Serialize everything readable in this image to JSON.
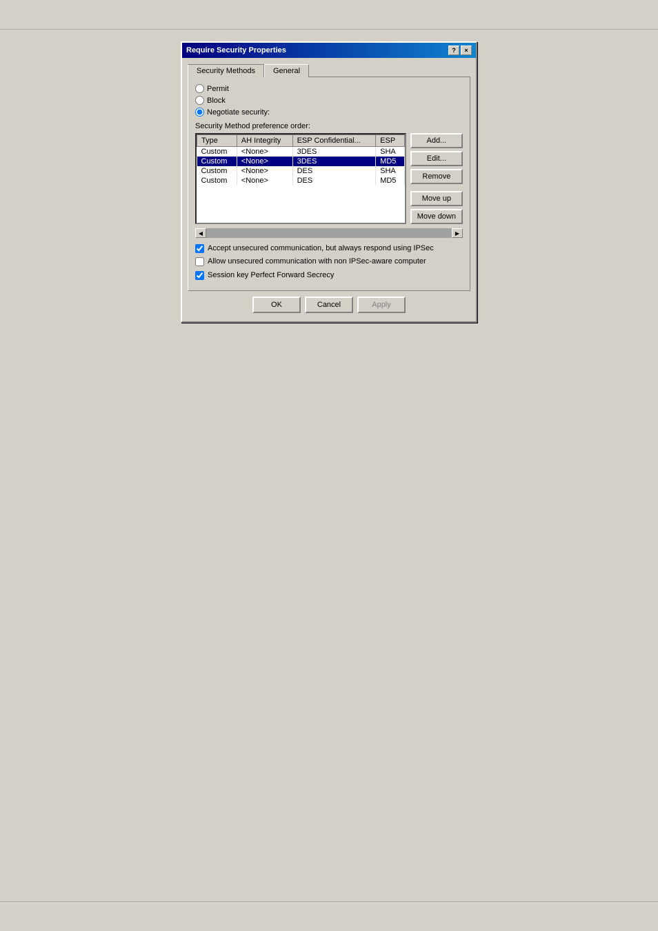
{
  "dialog": {
    "title": "Require Security Properties",
    "help_btn": "?",
    "close_btn": "×"
  },
  "tabs": [
    {
      "label": "Security Methods",
      "active": true
    },
    {
      "label": "General",
      "active": false
    }
  ],
  "radio_options": [
    {
      "id": "permit",
      "label": "Permit",
      "checked": false
    },
    {
      "id": "block",
      "label": "Block",
      "checked": false
    },
    {
      "id": "negotiate",
      "label": "Negotiate security:",
      "checked": true
    }
  ],
  "section_label": "Security Method preference order:",
  "table": {
    "columns": [
      "Type",
      "AH Integrity",
      "ESP Confidential...",
      "ESP"
    ],
    "rows": [
      [
        "Custom",
        "<None>",
        "3DES",
        "SHA"
      ],
      [
        "Custom",
        "<None>",
        "3DES",
        "MD5"
      ],
      [
        "Custom",
        "<None>",
        "DES",
        "SHA"
      ],
      [
        "Custom",
        "<None>",
        "DES",
        "MD5"
      ]
    ],
    "selected_row": 1
  },
  "buttons": {
    "add": "Add...",
    "edit": "Edit...",
    "remove": "Remove",
    "move_up": "Move up",
    "move_down": "Move down"
  },
  "checkboxes": [
    {
      "id": "accept_unsecured",
      "label": "Accept unsecured communication, but always respond using IPSec",
      "checked": true
    },
    {
      "id": "allow_unsecured",
      "label": "Allow unsecured communication with non IPSec-aware computer",
      "checked": false
    },
    {
      "id": "session_key",
      "label": "Session key Perfect Forward Secrecy",
      "checked": true
    }
  ],
  "bottom_buttons": {
    "ok": "OK",
    "cancel": "Cancel",
    "apply": "Apply"
  }
}
